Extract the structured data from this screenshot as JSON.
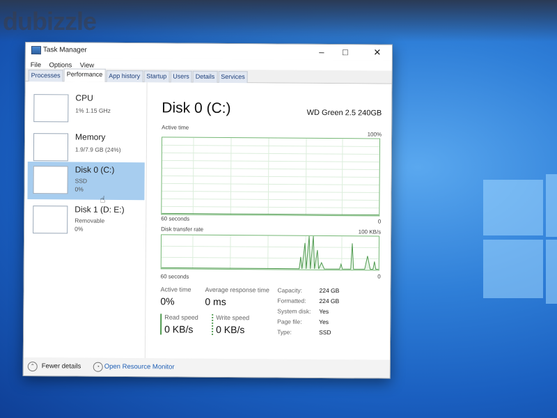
{
  "watermark": "dubizzle",
  "window": {
    "title": "Task Manager",
    "minimize": "–",
    "maximize": "□",
    "close": "✕"
  },
  "menu": [
    "File",
    "Options",
    "View"
  ],
  "tabs": [
    "Processes",
    "Performance",
    "App history",
    "Startup",
    "Users",
    "Details",
    "Services"
  ],
  "active_tab": "Performance",
  "sidebar": [
    {
      "name": "CPU",
      "line1": "1% 1.15 GHz",
      "line2": ""
    },
    {
      "name": "Memory",
      "line1": "1.9/7.9 GB (24%)",
      "line2": ""
    },
    {
      "name": "Disk 0 (C:)",
      "line1": "SSD",
      "line2": "0%"
    },
    {
      "name": "Disk 1 (D: E:)",
      "line1": "Removable",
      "line2": "0%"
    }
  ],
  "selected_item": "Disk 0 (C:)",
  "detail": {
    "title": "Disk 0 (C:)",
    "model": "WD Green 2.5 240GB",
    "graph1": {
      "label": "Active time",
      "max": "100%",
      "time": "60 seconds",
      "min": "0"
    },
    "graph2": {
      "label": "Disk transfer rate",
      "max": "100 KB/s",
      "time": "60 seconds",
      "min": "0"
    },
    "stats": {
      "active_time_label": "Active time",
      "active_time": "0%",
      "resp_label": "Average response time",
      "resp": "0 ms",
      "read_label": "Read speed",
      "read": "0 KB/s",
      "write_label": "Write speed",
      "write": "0 KB/s"
    },
    "props": [
      {
        "label": "Capacity:",
        "value": "224 GB"
      },
      {
        "label": "Formatted:",
        "value": "224 GB"
      },
      {
        "label": "System disk:",
        "value": "Yes"
      },
      {
        "label": "Page file:",
        "value": "Yes"
      },
      {
        "label": "Type:",
        "value": "SSD"
      }
    ]
  },
  "footer": {
    "fewer": "Fewer details",
    "resmon": "Open Resource Monitor"
  },
  "colors": {
    "accent": "#a7cdef",
    "graph_line": "#74b774",
    "link": "#1f5fb5"
  }
}
